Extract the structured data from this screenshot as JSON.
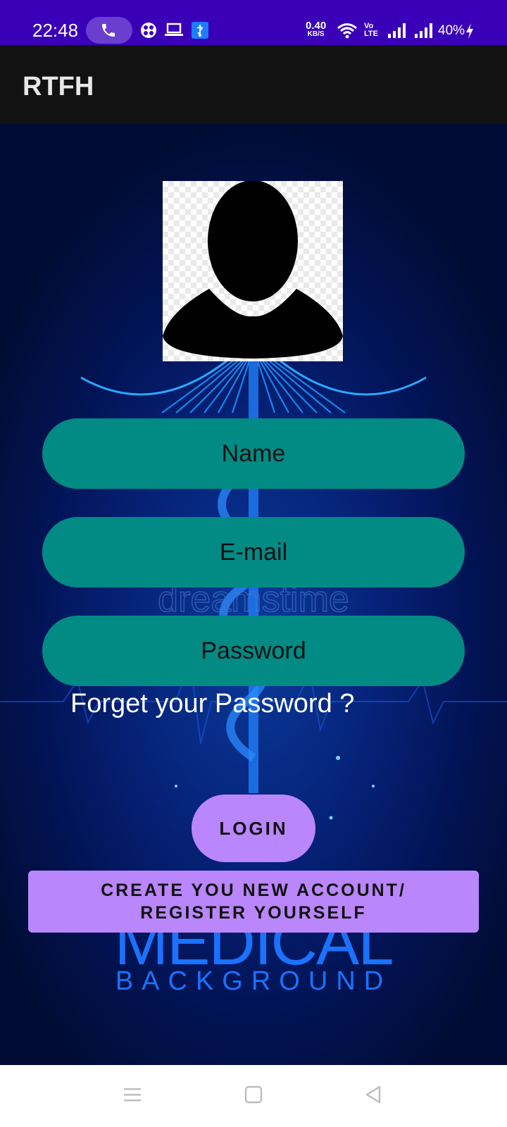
{
  "status_bar": {
    "time": "22:48",
    "net_speed_value": "0.40",
    "net_speed_unit": "KB/S",
    "volte_line1": "Vo",
    "volte_line2": "LTE",
    "battery_percent": "40%"
  },
  "app_bar": {
    "title": "RTFH"
  },
  "form": {
    "name_placeholder": "Name",
    "email_placeholder": "E-mail",
    "password_placeholder": "Password",
    "forgot_link": "Forget your Password ?",
    "login_button": "LOGIN",
    "register_button_line1": "CREATE YOU NEW ACCOUNT/",
    "register_button_line2": "REGISTER YOURSELF"
  },
  "background": {
    "watermark": "dreamstime",
    "title": "MEDICAL",
    "subtitle": "BACKGROUND"
  },
  "colors": {
    "status_bar": "#3a00b8",
    "app_bar": "#121212",
    "field_fill": "#028a85",
    "button_fill": "#ba86fc"
  }
}
